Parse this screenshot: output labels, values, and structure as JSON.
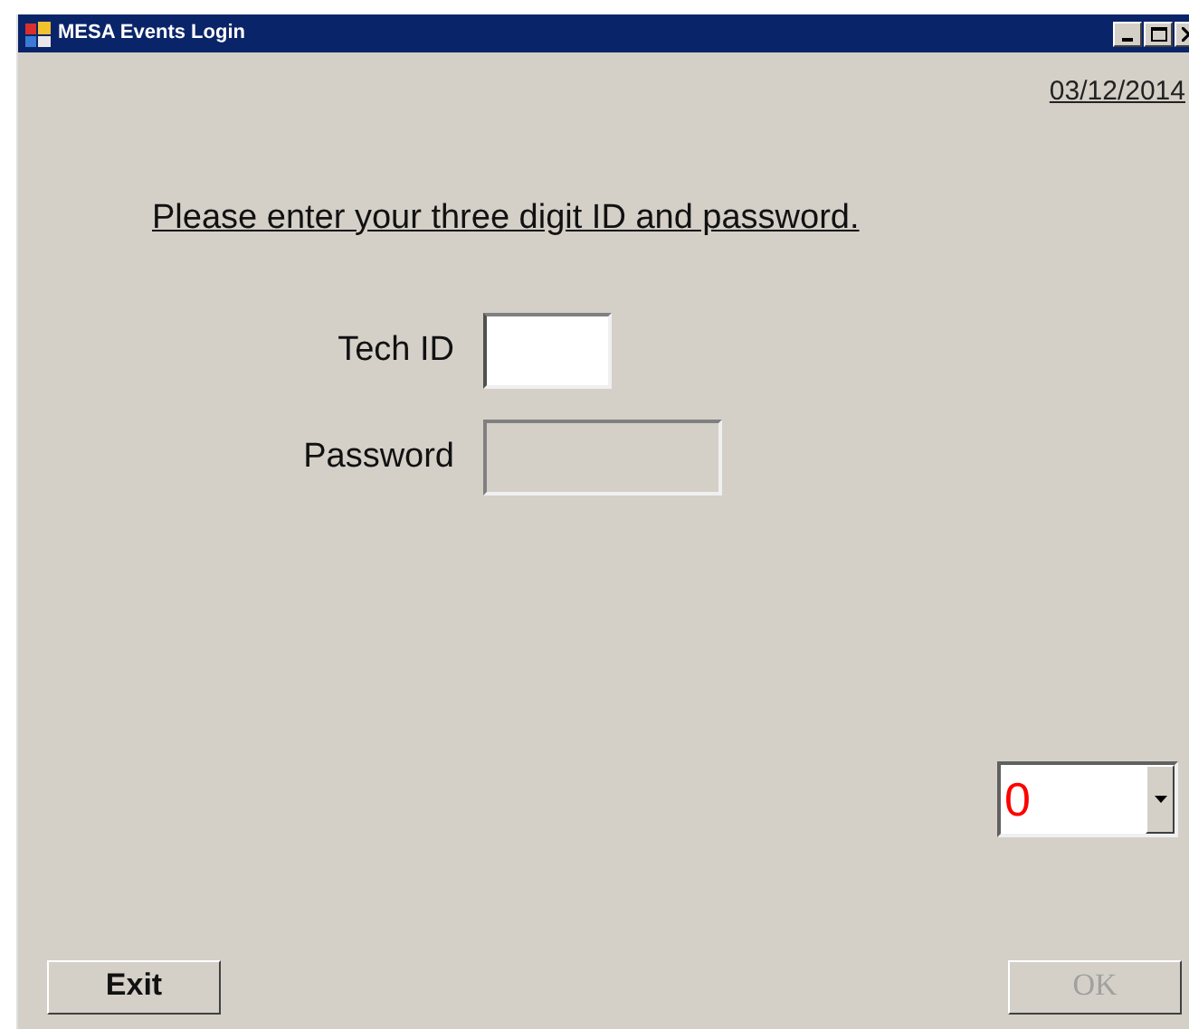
{
  "window": {
    "title": "MESA Events Login"
  },
  "date": "03/12/2014",
  "instruction": "Please enter your three digit ID and password.",
  "fields": [
    {
      "label": "Tech ID",
      "disabled": false
    },
    {
      "label": "Password",
      "disabled": true
    }
  ],
  "combo": {
    "value": "0"
  },
  "buttons": [
    {
      "label": "Exit",
      "disabled": false
    },
    {
      "label": "OK",
      "disabled": true
    }
  ]
}
